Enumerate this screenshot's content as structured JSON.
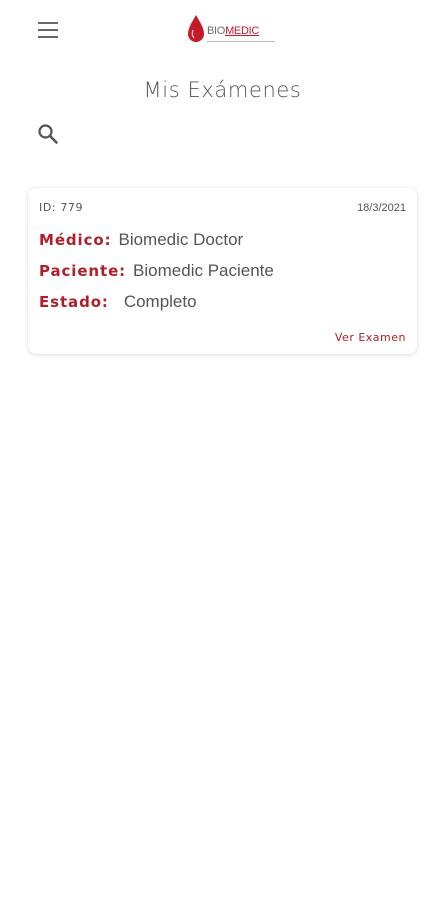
{
  "app": {
    "logo_text_left": "BIO",
    "logo_text_right": "MEDIC",
    "brand_color": "#c41b2a",
    "accent_color": "#b01e29"
  },
  "header": {
    "menu_icon": "hamburger-menu-icon"
  },
  "page": {
    "title": "Mis Exámenes",
    "search_icon": "search-icon"
  },
  "exams": [
    {
      "id_text": "ID: 779",
      "date": "18/3/2021",
      "medico_label": "Médico:",
      "medico_value": "Biomedic Doctor",
      "paciente_label": "Paciente:",
      "paciente_value": "Biomedic Paciente",
      "estado_label": "Estado:",
      "estado_value": "Completo",
      "action_label": "Ver Examen"
    }
  ]
}
